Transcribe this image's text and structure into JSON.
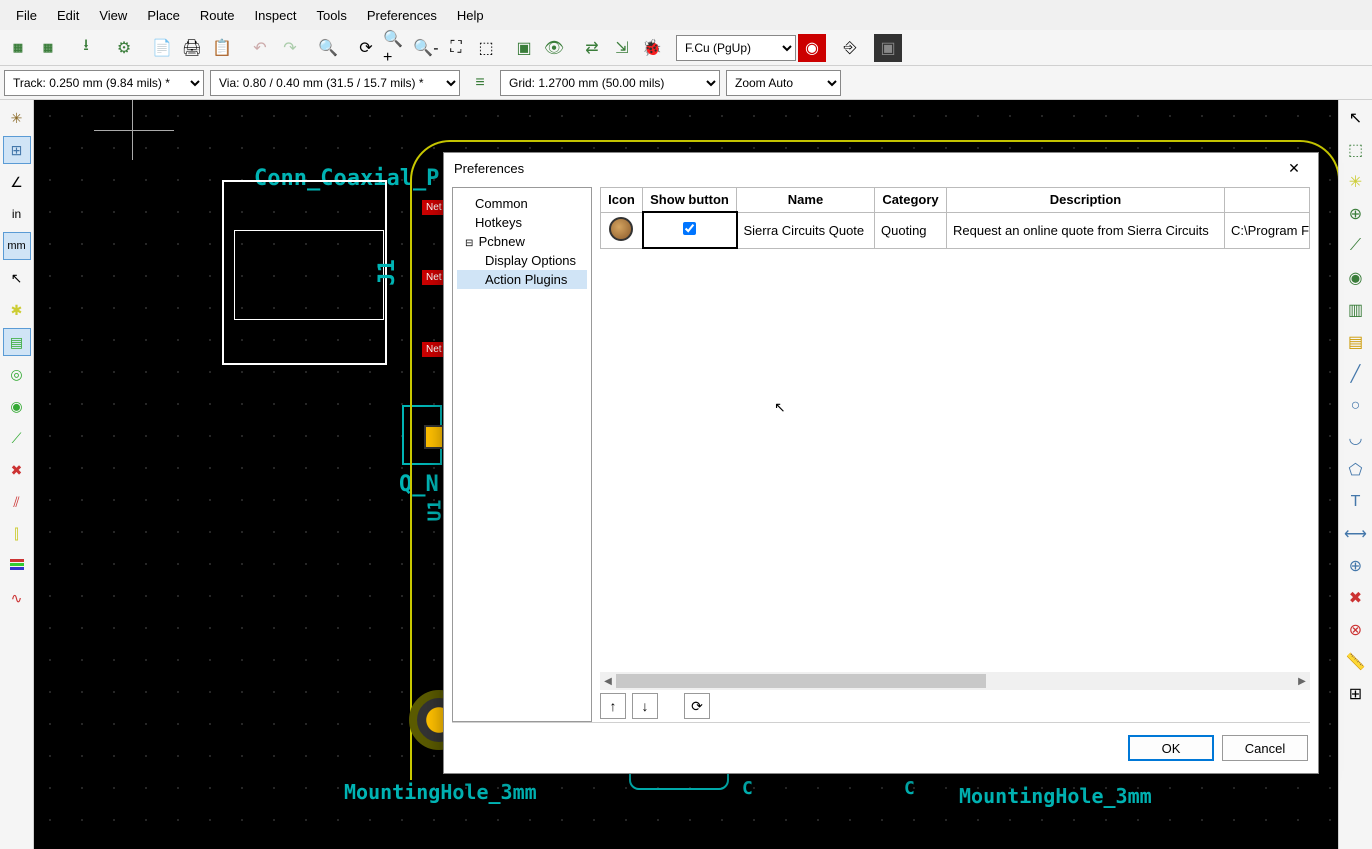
{
  "menu": [
    "File",
    "Edit",
    "View",
    "Place",
    "Route",
    "Inspect",
    "Tools",
    "Preferences",
    "Help"
  ],
  "layer_select": "F.Cu (PgUp)",
  "track_select": "Track: 0.250 mm (9.84 mils) *",
  "via_select": "Via: 0.80 / 0.40 mm (31.5 / 15.7 mils) *",
  "grid_select": "Grid: 1.2700 mm (50.00 mils)",
  "zoom_select": "Zoom Auto",
  "canvas": {
    "conn_label": "Conn_Coaxial_P",
    "j1": "J1",
    "qn": "Q_N",
    "u1": "U1",
    "mh1": "MountingHole_3mm",
    "mh2": "MountingHole_3mm",
    "c1": "C",
    "c2": "C",
    "net": "Net"
  },
  "dialog": {
    "title": "Preferences",
    "tree": {
      "common": "Common",
      "hotkeys": "Hotkeys",
      "pcbnew": "Pcbnew",
      "display": "Display Options",
      "action": "Action Plugins"
    },
    "headers": {
      "icon": "Icon",
      "show": "Show button",
      "name": "Name",
      "category": "Category",
      "description": "Description"
    },
    "row": {
      "show_checked": true,
      "name": "Sierra Circuits Quote",
      "category": "Quoting",
      "description": "Request an online quote from Sierra Circuits",
      "path": "C:\\Program Fi"
    },
    "ok": "OK",
    "cancel": "Cancel"
  },
  "left_tools": {
    "in": "in",
    "mm": "mm"
  }
}
